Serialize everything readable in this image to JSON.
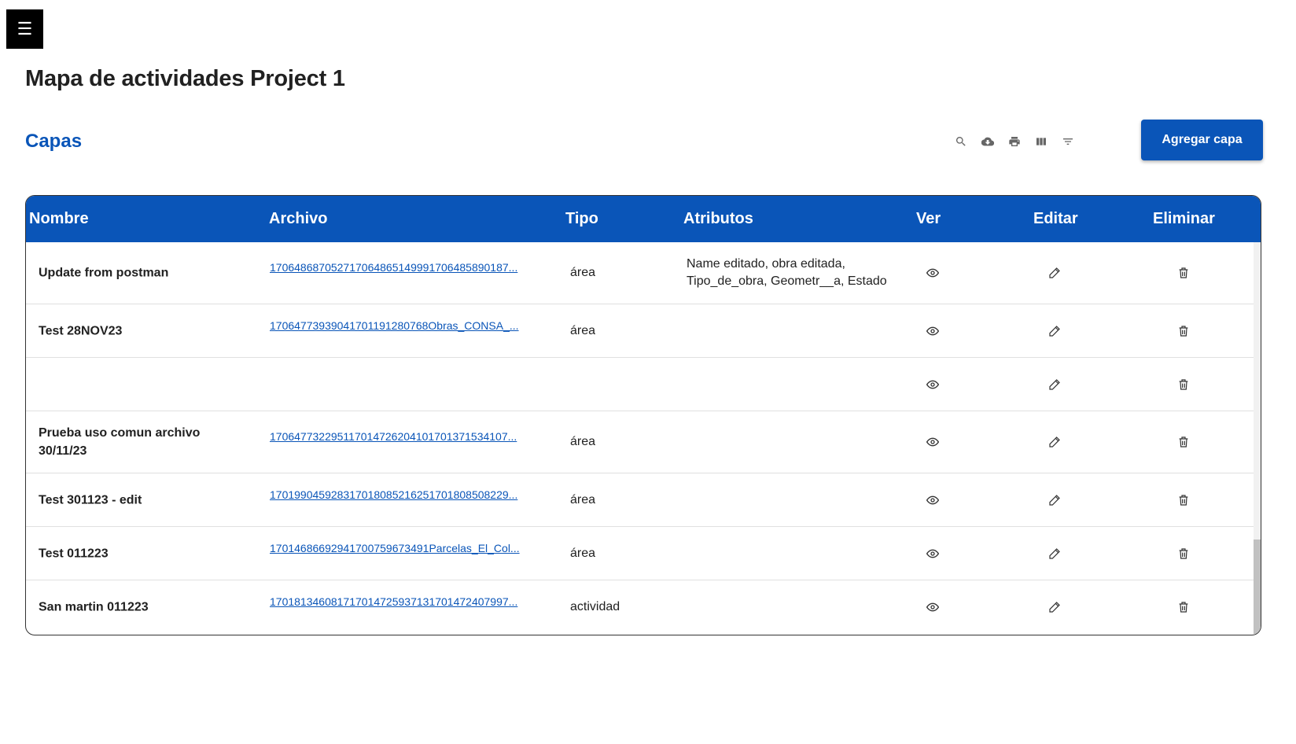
{
  "header": {
    "menu_icon": "☰",
    "title": "Mapa de actividades Project 1"
  },
  "section": {
    "title": "Capas",
    "add_button": "Agregar capa"
  },
  "toolbar": {
    "icons": [
      "search-icon",
      "cloud-download-icon",
      "print-icon",
      "columns-icon",
      "filter-icon"
    ]
  },
  "table": {
    "columns": [
      "Nombre",
      "Archivo",
      "Tipo",
      "Atributos",
      "Ver",
      "Editar",
      "Eliminar"
    ],
    "rows": [
      {
        "nombre": "Update from postman",
        "archivo": "17064868705271706486514999170648589018​7...",
        "tipo": "área",
        "atributos": "Name editado, obra editada, Tipo_de_obra, Geometr__a, Estado"
      },
      {
        "nombre": "Test 28NOV23",
        "archivo": "1706477393904170119128076​8Obras_CONSA_...",
        "tipo": "área",
        "atributos": ""
      },
      {
        "nombre": "",
        "archivo": "",
        "tipo": "",
        "atributos": ""
      },
      {
        "nombre": "Prueba uso comun archivo 30/11/23",
        "archivo": "17064773229511701472620410170137153410​7...",
        "tipo": "área",
        "atributos": ""
      },
      {
        "nombre": "Test 301123 - edit",
        "archivo": "17019904592831701808521625170180850822​9...",
        "tipo": "área",
        "atributos": ""
      },
      {
        "nombre": "Test 011223",
        "archivo": "17014686692941700759673491Parcelas_El_Col...",
        "tipo": "área",
        "atributos": ""
      },
      {
        "nombre": "San martin 011223",
        "archivo": "17018134608171701472593713170147240799​7...",
        "tipo": "actividad",
        "atributos": ""
      }
    ]
  }
}
